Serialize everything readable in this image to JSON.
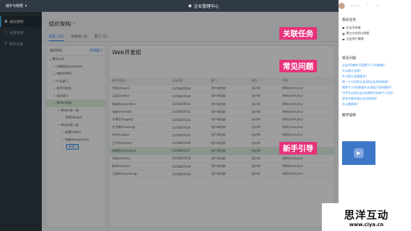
{
  "topbar": {
    "brand": "城乡与权限",
    "center_title": "企业管理中心",
    "user_name": "Amie"
  },
  "sidebar": {
    "items": [
      {
        "label": "组织架构",
        "icon": "org-icon",
        "active": true
      },
      {
        "label": "权限管理",
        "icon": "lock-icon",
        "active": false
      },
      {
        "label": "数字设置",
        "icon": "gear-icon",
        "active": false
      }
    ]
  },
  "main": {
    "title": "组织架构",
    "tabs": [
      {
        "label": "成员 (12)"
      },
      {
        "label": "待审核 (3)"
      },
      {
        "label": "部门 (2)"
      }
    ],
    "tree": {
      "header": "组织架构",
      "action": "新增部门",
      "nodes": [
        {
          "label": "腾讯公司",
          "level": 0
        },
        {
          "label": "刘晓明(pkuosteen)",
          "level": 1
        },
        {
          "label": "李刚(fiz90)",
          "level": 1
        },
        {
          "label": "产品部门",
          "level": 1
        },
        {
          "label": "技术开发组",
          "level": 1
        },
        {
          "label": "设计部门",
          "level": 1
        },
        {
          "label": "Web开发组",
          "level": 1,
          "selected": true
        },
        {
          "label": "Web开发一组",
          "level": 2
        },
        {
          "label": "余亮(shuyu)",
          "level": 3
        },
        {
          "label": "Web开发二组",
          "level": 2
        },
        {
          "label": "赵建(jinbiu)",
          "level": 3
        },
        {
          "label": "陈越(beckychen)",
          "level": 3
        },
        {
          "label": "新部门",
          "level": 3,
          "editing": true
        }
      ]
    },
    "panel": {
      "title": "Web开发组",
      "columns": [
        "帐号(姓名)",
        "企业QQ",
        "部门",
        "职位",
        "手机"
      ],
      "rows": [
        {
          "name": "余亮(shuyu)...",
          "qq": "2355887629",
          "dept": "用户体验部",
          "pos": "设计师",
          "phone": "李四(jimmyhu)"
        },
        {
          "name": "王某(anello)",
          "qq": "2355887630",
          "dept": "用户体验部",
          "pos": "设计师",
          "phone": "李四(jimmyhu)"
        },
        {
          "name": "陈越(beckychen)",
          "qq": "2355887631",
          "dept": "用户体验部",
          "pos": "设计师",
          "phone": "李四(jimmyhu)"
        },
        {
          "name": "张爽(monhdt)",
          "qq": "2355887632",
          "dept": "用户体验部",
          "pos": "设计师",
          "phone": "李四(jimmyhu)"
        },
        {
          "name": "付博文(hugefu)",
          "qq": "2355887633",
          "dept": "用户体验部",
          "pos": "设计师",
          "phone": "李四(jimmyhu)"
        },
        {
          "name": "孔令飘(lirhuang)",
          "qq": "2355887634",
          "dept": "用户体验部",
          "pos": "设计师",
          "phone": "李四(jimmyhu)"
        },
        {
          "name": "徐杰(xuabu)",
          "qq": "2355887635",
          "dept": "用户体验部",
          "pos": "设计师",
          "phone": "李四(jimmyhu)"
        },
        {
          "name": "王宇轩(timmy)",
          "qq": "2355887636",
          "dept": "用户体验部",
          "pos": "设计师",
          "phone": "李四(jimmyhu)"
        },
        {
          "name": "胡晓阳(jimmyhu)",
          "qq": "2355887637",
          "dept": "用户体验部",
          "pos": "设计师",
          "phone": "李四(jimmyhu)",
          "highlight": true
        },
        {
          "name": "尹铭(ammin)",
          "qq": "2355887638",
          "dept": "用户体验部",
          "pos": "设计师",
          "phone": "李四(jimmyhu)"
        },
        {
          "name": "陈雨(xiaojie)",
          "qq": "2355887639",
          "dept": "用户体验部",
          "pos": "设计师",
          "phone": "李四(jimmyhu)"
        },
        {
          "name": "王雅琴(xuyiwang)",
          "qq": "2355887640",
          "dept": "用户体验部",
          "pos": "设计师",
          "phone": "李四(jimmyhu)"
        }
      ]
    }
  },
  "right_panel": {
    "tasks_title": "相关任务",
    "tasks": [
      "企业号申请",
      "第三方应用与授权",
      "企业用户管理"
    ],
    "faq_title": "常见问题",
    "faq": [
      "企业QQ邮件可设置个人QQ邮箱？",
      "什么是企业版？",
      "什么是企业管理员？",
      "同一个公司的企业QQ企业如何转移？",
      "离职个人QQ数据什么进度下如何操作？",
      "可不可以把企业QQ改换号码给个人QQ？",
      "如何才能升级企业QQ的版？",
      "什么是群体？"
    ],
    "video_title": "教学视频"
  },
  "callouts": {
    "related_tasks": "关联任务",
    "faq": "常见问题",
    "guide": "新手引导"
  },
  "watermark": {
    "big": "思洋互动",
    "small": "www.ciya.cn"
  },
  "colors": {
    "accent": "#2d8cf0",
    "callout": "#e8317a",
    "sidebar": "#2f3a45"
  }
}
